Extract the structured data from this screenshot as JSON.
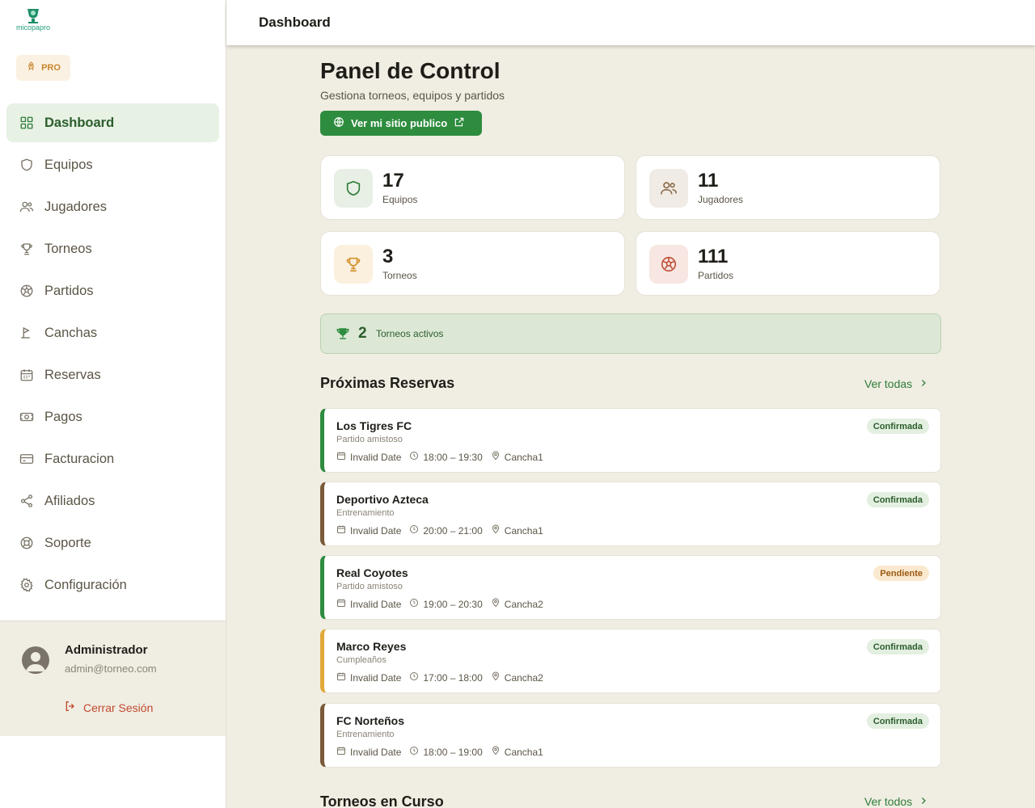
{
  "brand": {
    "name": "micopapro",
    "plan": "PRO"
  },
  "sidebar": {
    "items": [
      {
        "label": "Dashboard",
        "icon": "grid-icon",
        "active": true
      },
      {
        "label": "Equipos",
        "icon": "shield-icon"
      },
      {
        "label": "Jugadores",
        "icon": "users-icon"
      },
      {
        "label": "Torneos",
        "icon": "trophy-icon"
      },
      {
        "label": "Partidos",
        "icon": "soccer-ball-icon"
      },
      {
        "label": "Canchas",
        "icon": "flag-icon"
      },
      {
        "label": "Reservas",
        "icon": "calendar-icon"
      },
      {
        "label": "Pagos",
        "icon": "money-icon"
      },
      {
        "label": "Facturacion",
        "icon": "credit-card-icon"
      },
      {
        "label": "Afiliados",
        "icon": "share-icon"
      },
      {
        "label": "Soporte",
        "icon": "lifebuoy-icon"
      },
      {
        "label": "Configuración",
        "icon": "gear-icon"
      }
    ]
  },
  "user": {
    "name": "Administrador",
    "email": "admin@torneo.com",
    "logout_label": "Cerrar Sesión"
  },
  "topbar": {
    "title": "Dashboard"
  },
  "main": {
    "title": "Panel de Control",
    "subtitle": "Gestiona torneos, equipos y partidos",
    "public_site_label": "Ver mi sitio publico",
    "stats": [
      {
        "value": "17",
        "label": "Equipos",
        "icon": "shield-icon"
      },
      {
        "value": "11",
        "label": "Jugadores",
        "icon": "users-icon"
      },
      {
        "value": "3",
        "label": "Torneos",
        "icon": "trophy-icon"
      },
      {
        "value": "111",
        "label": "Partidos",
        "icon": "soccer-ball-icon"
      }
    ],
    "active_tournaments": {
      "count": "2",
      "label": "Torneos activos"
    },
    "reservations_title": "Próximas Reservas",
    "reservations_see_all": "Ver todas",
    "reservations": [
      {
        "name": "Los Tigres FC",
        "type": "Partido amistoso",
        "date": "Invalid Date",
        "time": "18:00 – 19:30",
        "court": "Cancha1",
        "status": "Confirmada",
        "accent": "#2e8c3f"
      },
      {
        "name": "Deportivo Azteca",
        "type": "Entrenamiento",
        "date": "Invalid Date",
        "time": "20:00 – 21:00",
        "court": "Cancha1",
        "status": "Confirmada",
        "accent": "#7a5a3a"
      },
      {
        "name": "Real Coyotes",
        "type": "Partido amistoso",
        "date": "Invalid Date",
        "time": "19:00 – 20:30",
        "court": "Cancha2",
        "status": "Pendiente",
        "accent": "#2e8c3f"
      },
      {
        "name": "Marco Reyes",
        "type": "Cumpleaños",
        "date": "Invalid Date",
        "time": "17:00 – 18:00",
        "court": "Cancha2",
        "status": "Confirmada",
        "accent": "#e0a93a"
      },
      {
        "name": "FC Norteños",
        "type": "Entrenamiento",
        "date": "Invalid Date",
        "time": "18:00 – 19:00",
        "court": "Cancha1",
        "status": "Confirmada",
        "accent": "#7a5a3a"
      }
    ],
    "tournaments_title": "Torneos en Curso",
    "tournaments_see_all": "Ver todos"
  }
}
